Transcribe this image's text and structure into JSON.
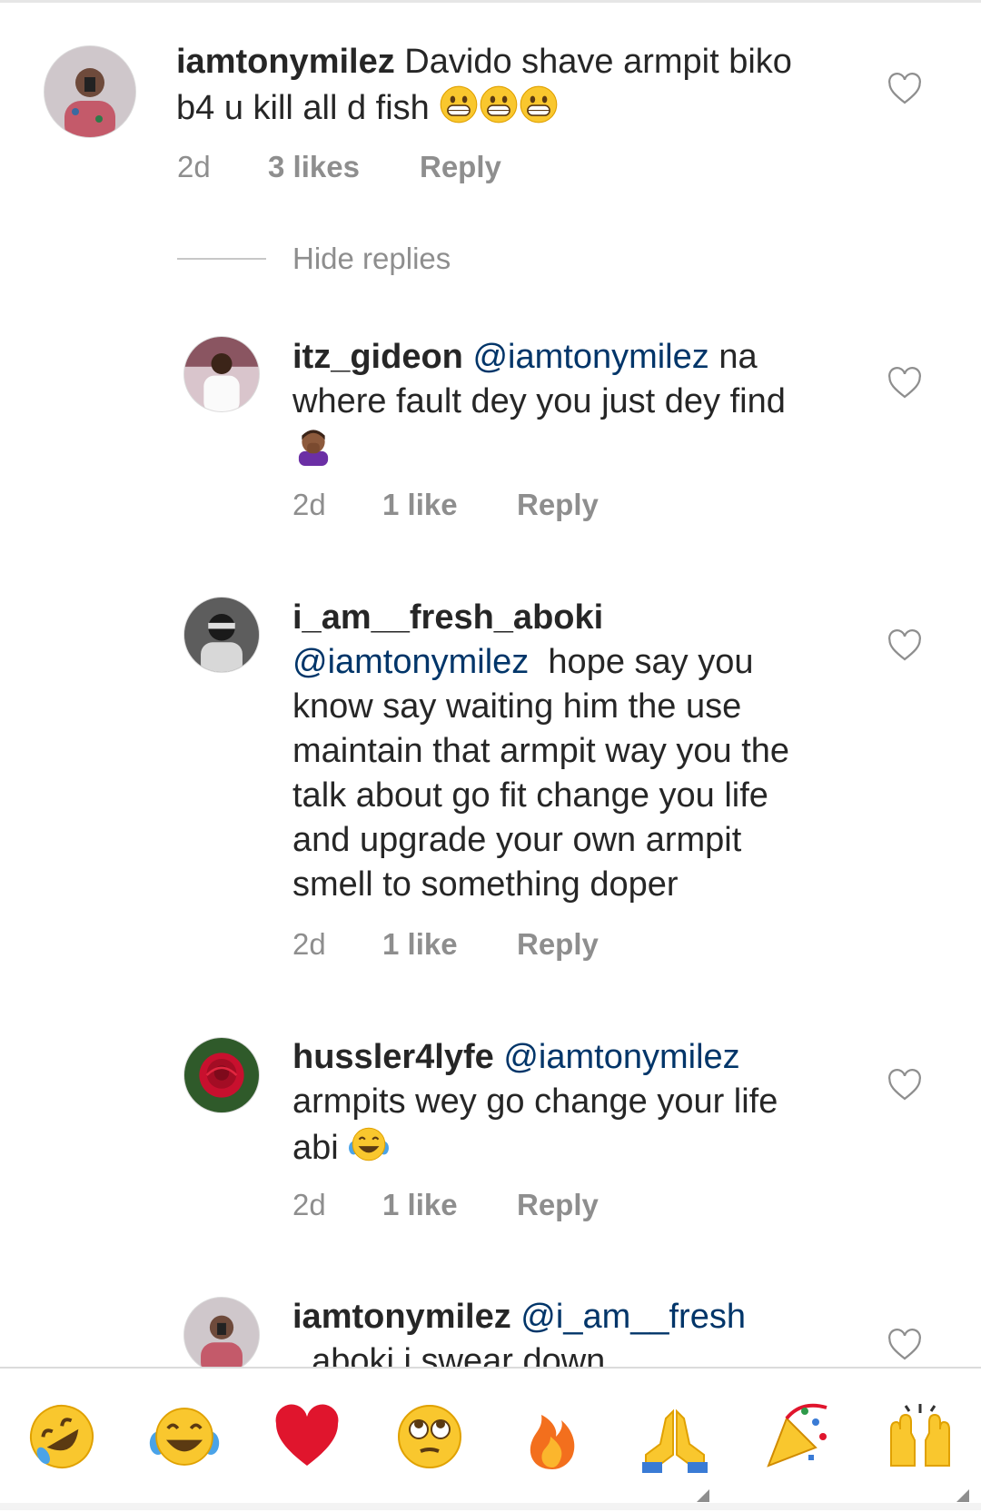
{
  "comments": [
    {
      "username": "iamtonymilez",
      "mention": "",
      "body_1": "Davido shave armpit biko",
      "body_2": "b4 u kill all d fish",
      "time": "2d",
      "likes": "3 likes",
      "reply": "Reply"
    },
    {
      "username": "itz_gideon",
      "mention": "@iamtonymilez",
      "body_1": " na",
      "body_2": "where fault dey you just dey find",
      "time": "2d",
      "likes": "1 like",
      "reply": "Reply"
    },
    {
      "username": "i_am__fresh_aboki",
      "mention": "@iamtonymilez",
      "lines": [
        "  hope say you",
        "know say waiting him the use",
        "maintain that armpit way you the",
        "talk about go fit change you life",
        "and upgrade your own armpit",
        "smell to something doper"
      ],
      "time": "2d",
      "likes": "1 like",
      "reply": "Reply"
    },
    {
      "username": "hussler4lyfe",
      "mention": "@iamtonymilez",
      "body_1": "armpits wey go change your life",
      "body_2": "abi ",
      "time": "2d",
      "likes": "1 like",
      "reply": "Reply"
    },
    {
      "username": "iamtonymilez",
      "mention": "@i_am__fresh",
      "body_2": "_aboki i swear down"
    }
  ],
  "hide_replies": "Hide replies",
  "emoji_bar": [
    "rolling-on-floor-laughing",
    "tears-of-joy",
    "red-heart",
    "rolling-eyes",
    "fire",
    "folded-hands",
    "party-popper",
    "raising-hands"
  ],
  "colors": {
    "mention": "#003569",
    "muted": "#8e8e8e",
    "text": "#262626"
  }
}
